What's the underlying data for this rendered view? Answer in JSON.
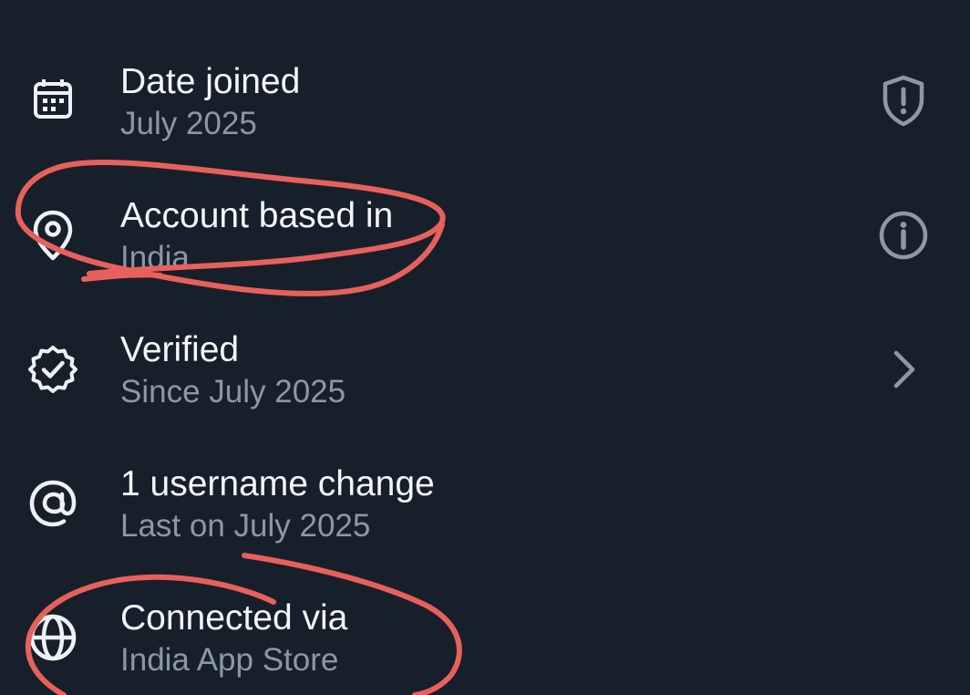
{
  "rows": [
    {
      "title": "Date joined",
      "subtitle": "July 2025",
      "icon": "calendar-icon",
      "trailing": "shield-alert-icon"
    },
    {
      "title": "Account based in",
      "subtitle": "India",
      "icon": "location-pin-icon",
      "trailing": "info-icon"
    },
    {
      "title": "Verified",
      "subtitle": "Since July 2025",
      "icon": "verified-badge-icon",
      "trailing": "chevron-right-icon"
    },
    {
      "title": "1 username change",
      "subtitle": "Last on July 2025",
      "icon": "at-sign-icon",
      "trailing": ""
    },
    {
      "title": "Connected via",
      "subtitle": "India App Store",
      "icon": "globe-icon",
      "trailing": ""
    }
  ],
  "colors": {
    "background": "#17202a",
    "title_text": "#f3f6f8",
    "subtitle_text": "#8a98a6",
    "trailing_icon": "#8b98a5",
    "annotation_stroke": "#e8605c"
  }
}
